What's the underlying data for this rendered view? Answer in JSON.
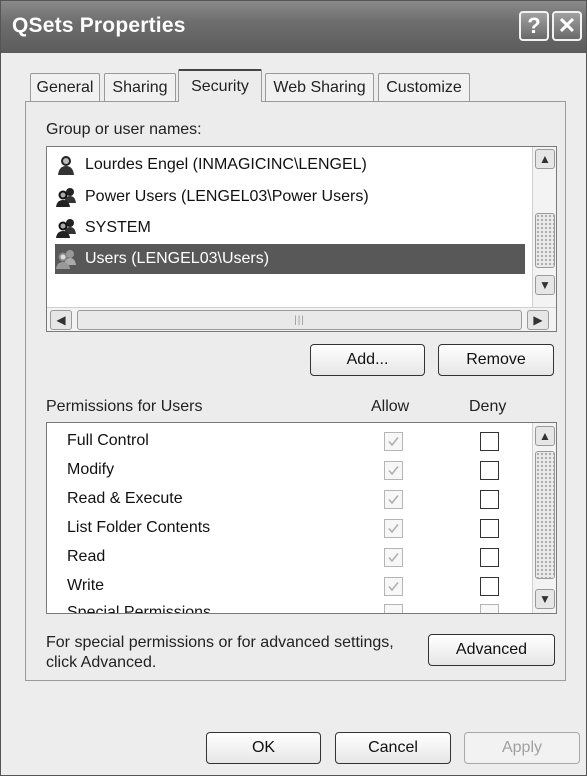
{
  "window": {
    "title": "QSets Properties"
  },
  "titlebar": {
    "help_glyph": "?",
    "close_glyph": "✕"
  },
  "tabs": [
    {
      "label": "General"
    },
    {
      "label": "Sharing"
    },
    {
      "label": "Security",
      "active": true
    },
    {
      "label": "Web Sharing"
    },
    {
      "label": "Customize"
    }
  ],
  "security": {
    "group_label": "Group or user names:",
    "users": [
      {
        "name": "Lourdes Engel (INMAGICINC\\LENGEL)",
        "icon": "single-user-icon"
      },
      {
        "name": "Power Users (LENGEL03\\Power Users)",
        "icon": "user-group-icon"
      },
      {
        "name": "SYSTEM",
        "icon": "user-group-icon"
      },
      {
        "name": "Users (LENGEL03\\Users)",
        "icon": "user-group-icon",
        "selected": true
      }
    ],
    "add_button": "Add...",
    "remove_button": "Remove",
    "permissions_label": "Permissions for Users",
    "allow_header": "Allow",
    "deny_header": "Deny",
    "permissions": [
      {
        "name": "Full Control",
        "allow": true,
        "allow_disabled": true,
        "deny": false
      },
      {
        "name": "Modify",
        "allow": true,
        "allow_disabled": true,
        "deny": false
      },
      {
        "name": "Read & Execute",
        "allow": true,
        "allow_disabled": true,
        "deny": false
      },
      {
        "name": "List Folder Contents",
        "allow": true,
        "allow_disabled": true,
        "deny": false
      },
      {
        "name": "Read",
        "allow": true,
        "allow_disabled": true,
        "deny": false
      },
      {
        "name": "Write",
        "allow": true,
        "allow_disabled": true,
        "deny": false
      },
      {
        "name": "Special Permissions",
        "allow": false,
        "allow_disabled": true,
        "deny": false
      }
    ],
    "advanced_text": "For special permissions or for advanced settings, click Advanced.",
    "advanced_button": "Advanced"
  },
  "footer": {
    "ok": "OK",
    "cancel": "Cancel",
    "apply": "Apply"
  },
  "colors": {
    "selection": "#585858",
    "titlebar": "#6e6e6e"
  }
}
